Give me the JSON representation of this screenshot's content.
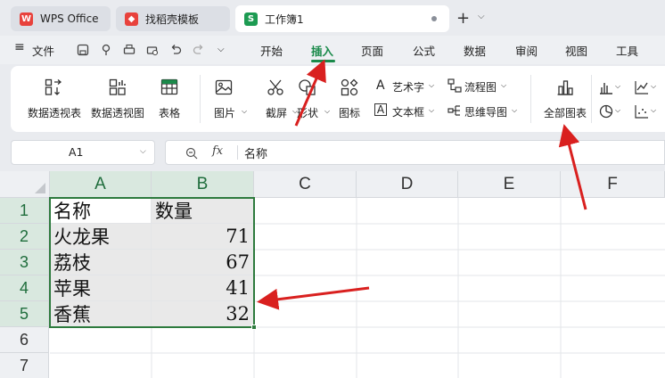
{
  "tabs": [
    {
      "label": "WPS Office",
      "icon": "wps-logo-icon",
      "active": false
    },
    {
      "label": "找稻壳模板",
      "icon": "docer-icon",
      "active": false
    },
    {
      "label": "工作簿1",
      "icon": "spreadsheet-s-icon",
      "icon_text": "S",
      "active": true
    }
  ],
  "menu": {
    "file_label": "文件",
    "tabs": [
      "开始",
      "插入",
      "页面",
      "公式",
      "数据",
      "审阅",
      "视图",
      "工具"
    ],
    "active_tab": "插入"
  },
  "ribbon": {
    "pivot_table": "数据透视表",
    "pivot_chart": "数据透视图",
    "table": "表格",
    "picture": "图片",
    "screenshot": "截屏",
    "shape": "形状",
    "icon": "图标",
    "wordart": "艺术字",
    "textbox": "文本框",
    "flowchart": "流程图",
    "mindmap": "思维导图",
    "all_charts": "全部图表"
  },
  "formula_bar": {
    "cell_ref": "A1",
    "fx": "fx",
    "content": "名称"
  },
  "sheet": {
    "columns": [
      "A",
      "B",
      "C",
      "D",
      "E",
      "F"
    ],
    "rows": [
      "1",
      "2",
      "3",
      "4",
      "5",
      "6",
      "7"
    ],
    "header": {
      "a": "名称",
      "b": "数量"
    },
    "data": [
      {
        "a": "火龙果",
        "b": "71"
      },
      {
        "a": "荔枝",
        "b": "67"
      },
      {
        "a": "苹果",
        "b": "41"
      },
      {
        "a": "香蕉",
        "b": "32"
      }
    ]
  },
  "colors": {
    "accent": "#1a8a4a",
    "selection": "#2d7a3d",
    "arrow": "#d9201f",
    "wps_red": "#e8423c"
  }
}
